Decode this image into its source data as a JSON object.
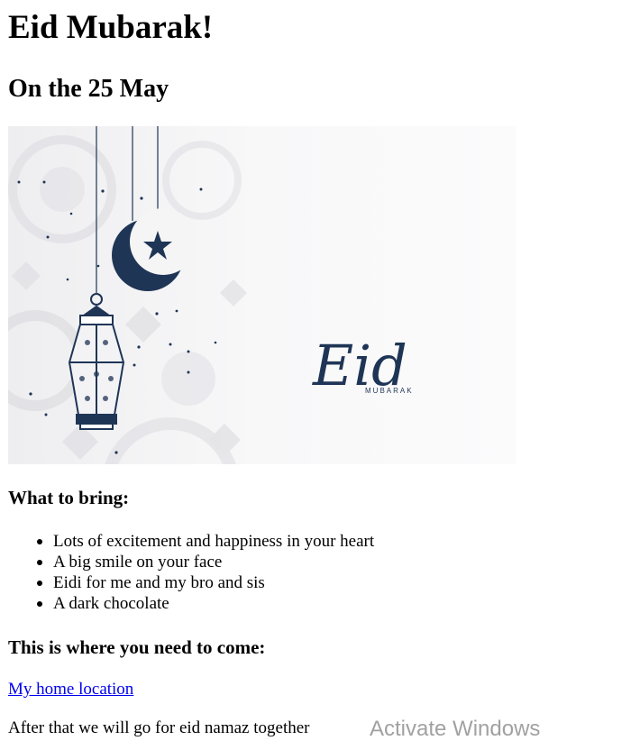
{
  "page": {
    "title": "Eid Mubarak!",
    "subtitle": "On the 25 May"
  },
  "hero": {
    "script_text": "Eid",
    "small_text": "MUBARAK",
    "colors": {
      "ink": "#1f3556",
      "background": "#f7f7f8",
      "pattern": "#e4e4e7"
    }
  },
  "bring": {
    "heading": "What to bring:",
    "items": [
      "Lots of excitement and happiness in your heart",
      "A big smile on your face",
      "Eidi for me and my bro and sis",
      "A dark chocolate"
    ]
  },
  "location": {
    "heading": "This is where you need to come:",
    "link_text": "My home location"
  },
  "footer": {
    "text": "After that we will go for eid namaz together"
  },
  "os_overlay": {
    "watermark": "Activate Windows"
  }
}
